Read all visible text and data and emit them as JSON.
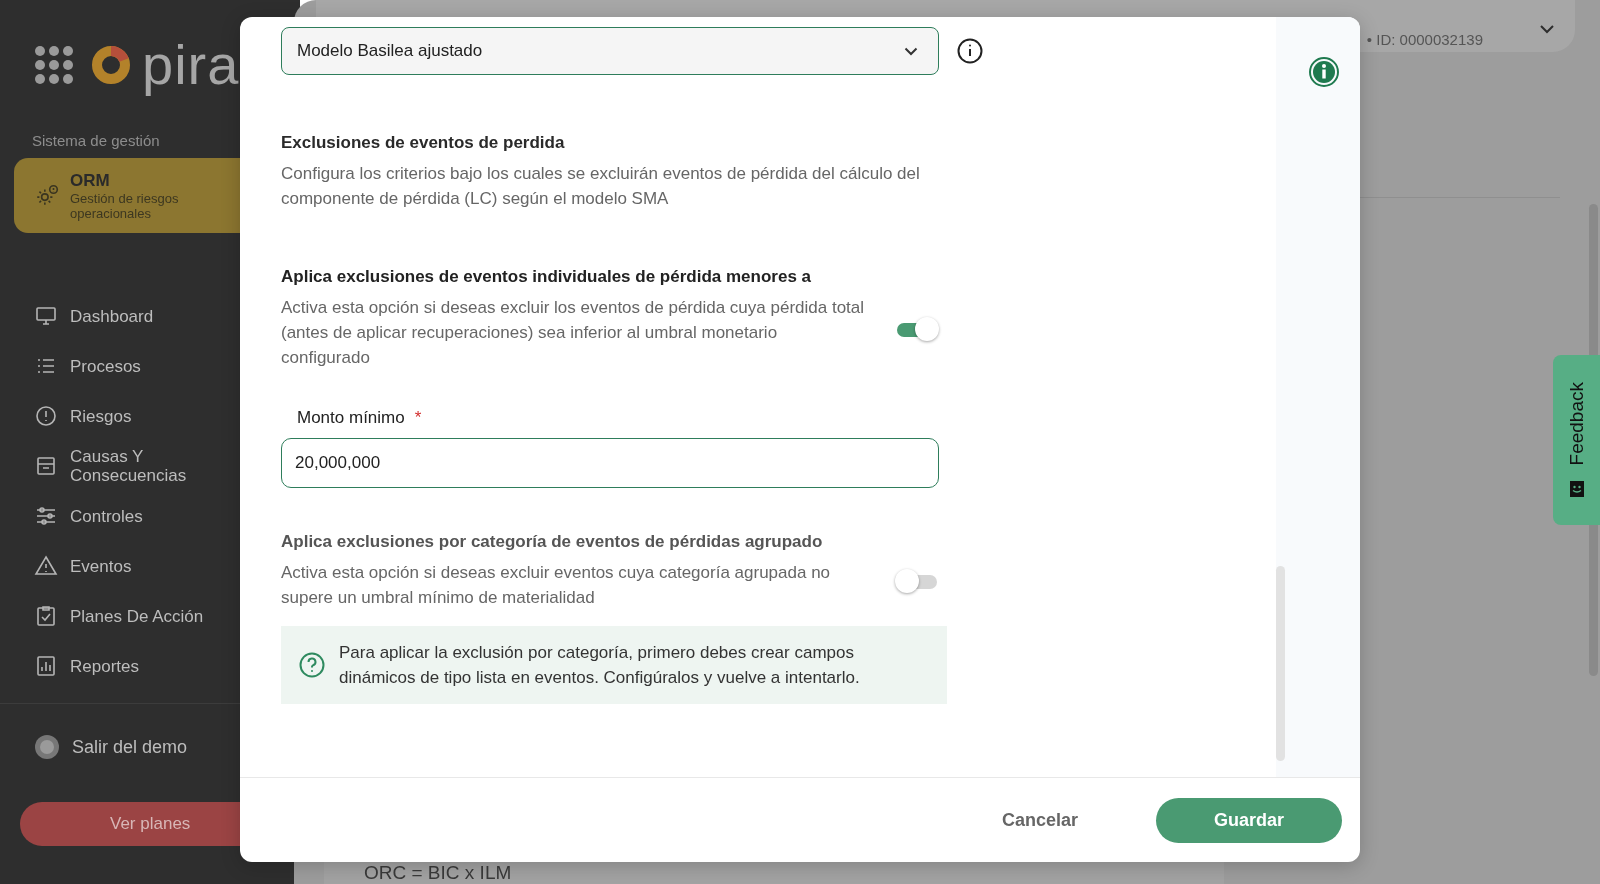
{
  "brand": {
    "logo_text": "pira"
  },
  "sidebar": {
    "section_label": "Sistema de gestión",
    "module": {
      "title": "ORM",
      "subtitle": "Gestión de riesgos operacionales"
    },
    "items": [
      {
        "label": "Dashboard",
        "kind": "monitor"
      },
      {
        "label": "Procesos",
        "kind": "list"
      },
      {
        "label": "Riesgos",
        "kind": "alert"
      },
      {
        "label": "Causas Y Consecuencias",
        "kind": "archive"
      },
      {
        "label": "Controles",
        "kind": "sliders"
      },
      {
        "label": "Eventos",
        "kind": "warning"
      },
      {
        "label": "Planes De Acción",
        "kind": "checklist"
      },
      {
        "label": "Reportes",
        "kind": "chart"
      }
    ],
    "exit": "Salir del demo",
    "plans_button": "Ver planes"
  },
  "background": {
    "user_id": "• ID: 0000032139",
    "formula": "ORC = BIC x ILM"
  },
  "modal": {
    "model_select": {
      "value": "Modelo Basilea ajustado"
    },
    "section": {
      "title": "Exclusiones de eventos de perdida",
      "description": "Configura los criterios bajo los cuales se excluirán eventos de pérdida del cálculo del componente de pérdida (LC) según el modelo SMA"
    },
    "individual_exclusion": {
      "title": "Aplica exclusiones de eventos individuales de pérdida menores a",
      "description": "Activa esta opción si deseas excluir los eventos de pérdida cuya pérdida total (antes de aplicar recuperaciones) sea inferior al umbral monetario configurado",
      "on": true
    },
    "amount_field": {
      "label": "Monto mínimo",
      "required_mark": "*",
      "value": "20,000,000"
    },
    "category_exclusion": {
      "title": "Aplica exclusiones por categoría de eventos de pérdidas agrupado",
      "description": "Activa esta opción si deseas excluir eventos cuya categoría agrupada no supere un umbral mínimo de materialidad",
      "on": false
    },
    "notice": "Para aplicar la exclusión por categoría, primero debes crear campos dinámicos de tipo lista en eventos. Configúralos y vuelve a intentarlo.",
    "footer": {
      "cancel": "Cancelar",
      "save": "Guardar"
    }
  },
  "feedback": {
    "label": "Feedback"
  }
}
